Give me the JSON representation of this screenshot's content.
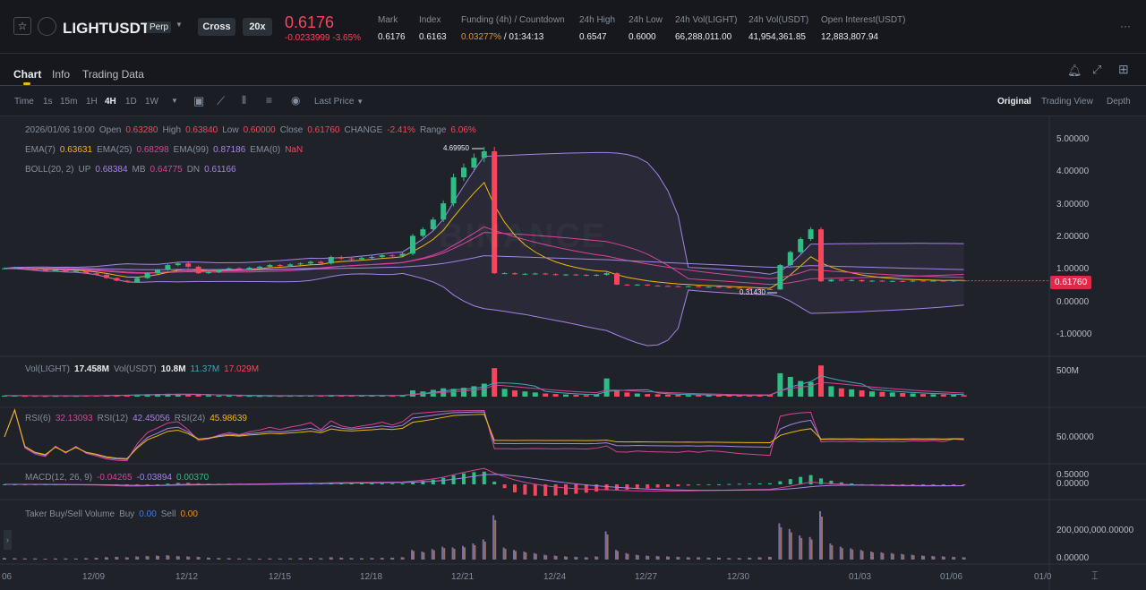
{
  "header": {
    "symbol": "LIGHTUSDT",
    "contract": "Perp",
    "margin_mode": "Cross",
    "leverage": "20x",
    "last_price": "0.6176",
    "change": "-0.0233999",
    "change_pct": "-3.65%",
    "stats": [
      {
        "label": "Mark",
        "value": "0.6176"
      },
      {
        "label": "Index",
        "value": "0.6163"
      },
      {
        "label": "Funding (4h) / Countdown",
        "value": "0.03277%",
        "value2": "/ 01:34:13"
      },
      {
        "label": "24h High",
        "value": "0.6547"
      },
      {
        "label": "24h Low",
        "value": "0.6000"
      },
      {
        "label": "24h Vol(LIGHT)",
        "value": "66,288,011.00"
      },
      {
        "label": "24h Vol(USDT)",
        "value": "41,954,361.85"
      },
      {
        "label": "Open Interest(USDT)",
        "value": "12,883,807.94"
      }
    ],
    "more": "···"
  },
  "tabs": [
    "Chart",
    "Info",
    "Trading Data"
  ],
  "toolbar": {
    "intervals": [
      "Time",
      "1s",
      "15m",
      "1H",
      "4H",
      "1D",
      "1W"
    ],
    "active": "4H",
    "price_type": "Last Price",
    "views": [
      "Original",
      "Trading View",
      "Depth"
    ]
  },
  "legend": {
    "ohlc": {
      "time": "2026/01/06 19:00",
      "open_l": "Open",
      "open": "0.63280",
      "high_l": "High",
      "high": "0.63840",
      "low_l": "Low",
      "low": "0.60000",
      "close_l": "Close",
      "close": "0.61760",
      "change_l": "CHANGE",
      "change": "-2.41%",
      "range_l": "Range",
      "range": "6.06%"
    },
    "ema": {
      "l7": "EMA(7)",
      "v7": "0.63631",
      "l25": "EMA(25)",
      "v25": "0.68298",
      "l99": "EMA(99)",
      "v99": "0.87186",
      "l0": "EMA(0)",
      "v0": "NaN"
    },
    "boll": {
      "l": "BOLL(20, 2)",
      "up_l": "UP",
      "up": "0.68384",
      "mb_l": "MB",
      "mb": "0.64775",
      "dn_l": "DN",
      "dn": "0.61166"
    },
    "vol": {
      "l1": "Vol(LIGHT)",
      "v1": "17.458M",
      "l2": "Vol(USDT)",
      "v2": "10.8M",
      "v3": "11.37M",
      "v4": "17.029M"
    },
    "rsi": {
      "l6": "RSI(6)",
      "v6": "32.13093",
      "l12": "RSI(12)",
      "v12": "42.45056",
      "l24": "RSI(24)",
      "v24": "45.98639"
    },
    "macd": {
      "l": "MACD(12, 26, 9)",
      "dif": "-0.04265",
      "dea": "-0.03894",
      "hist": "0.00370"
    },
    "taker": {
      "l": "Taker Buy/Sell Volume",
      "buy_l": "Buy",
      "buy": "0.00",
      "sell_l": "Sell",
      "sell": "0.00"
    }
  },
  "annotations": {
    "high": "4.69950",
    "low": "0.31430",
    "last_tag": "0.61760",
    "watermark": "BINANCE"
  },
  "chart_data": {
    "type": "candlestick",
    "price_axis": [
      "5.00000",
      "4.00000",
      "3.00000",
      "2.00000",
      "1.00000",
      "0.00000",
      "-1.00000"
    ],
    "vol_axis": "500M",
    "rsi_axis": "50.00000",
    "macd_axis": [
      "0.50000",
      "0.00000"
    ],
    "taker_axis": [
      "200,000,000.00000",
      "0.00000"
    ],
    "time_axis": [
      "06",
      "12/09",
      "12/12",
      "12/15",
      "12/18",
      "12/21",
      "12/24",
      "12/27",
      "12/30",
      "01/03",
      "01/06",
      "01/0"
    ],
    "closes": [
      1.0,
      1.02,
      0.98,
      0.95,
      0.93,
      0.95,
      0.9,
      0.92,
      0.85,
      0.8,
      0.7,
      0.62,
      0.58,
      0.7,
      0.85,
      0.95,
      1.1,
      1.15,
      1.05,
      0.85,
      0.88,
      0.95,
      1.0,
      0.97,
      1.02,
      1.05,
      1.1,
      1.08,
      1.12,
      1.15,
      1.2,
      1.15,
      1.35,
      1.3,
      1.28,
      1.32,
      1.35,
      1.4,
      1.38,
      1.45,
      2.0,
      2.2,
      2.5,
      3.0,
      3.8,
      4.1,
      4.4,
      4.6,
      0.85,
      0.85,
      0.82,
      0.83,
      0.84,
      0.82,
      0.8,
      0.81,
      0.8,
      0.78,
      0.8,
      0.85,
      0.5,
      0.48,
      0.5,
      0.47,
      0.46,
      0.45,
      0.44,
      0.45,
      0.42,
      0.43,
      0.42,
      0.4,
      0.38,
      0.37,
      0.36,
      0.35,
      1.1,
      1.5,
      1.9,
      2.2,
      0.6,
      0.65,
      0.62,
      0.64,
      0.6,
      0.62,
      0.6,
      0.61,
      0.6,
      0.62,
      0.61,
      0.62,
      0.6,
      0.63,
      0.6176
    ],
    "volume_m": [
      20,
      18,
      15,
      15,
      12,
      14,
      15,
      14,
      18,
      22,
      30,
      35,
      30,
      40,
      45,
      50,
      55,
      45,
      40,
      35,
      25,
      20,
      18,
      15,
      14,
      12,
      15,
      14,
      16,
      18,
      20,
      18,
      30,
      25,
      20,
      18,
      20,
      22,
      25,
      30,
      120,
      100,
      130,
      160,
      150,
      170,
      200,
      250,
      550,
      150,
      120,
      100,
      80,
      60,
      50,
      40,
      35,
      30,
      40,
      350,
      120,
      80,
      60,
      50,
      45,
      40,
      35,
      30,
      30,
      25,
      25,
      20,
      20,
      25,
      30,
      35,
      450,
      380,
      300,
      280,
      600,
      200,
      160,
      140,
      120,
      100,
      90,
      80,
      70,
      60,
      50,
      45,
      40,
      35,
      30
    ]
  }
}
